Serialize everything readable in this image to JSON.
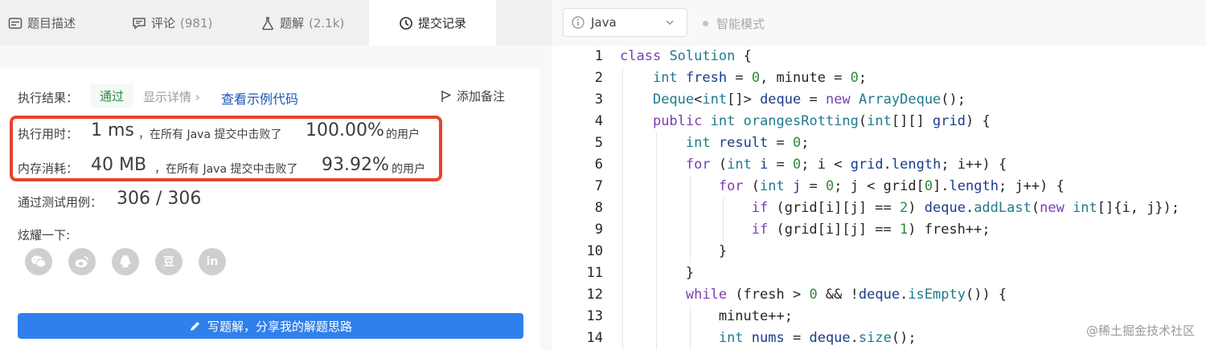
{
  "tabs": [
    {
      "label": "题目描述",
      "count": ""
    },
    {
      "label": "评论",
      "count": "(981)"
    },
    {
      "label": "题解",
      "count": "(2.1k)"
    },
    {
      "label": "提交记录",
      "count": ""
    }
  ],
  "result": {
    "label": "执行结果：",
    "status": "通过",
    "details": "显示详情 ›",
    "example": "查看示例代码",
    "note": "添加备注"
  },
  "runtime": {
    "label": "执行用时：",
    "value": "1 ms",
    "mid": "，在所有 Java 提交中击败了",
    "percent": "100.00%",
    "suffix": "的用户"
  },
  "memory": {
    "label": "内存消耗：",
    "value": "40 MB",
    "mid": "，在所有 Java 提交中击败了",
    "percent": "93.92%",
    "suffix": "的用户"
  },
  "tests": {
    "label": "通过测试用例：",
    "value": "306 / 306"
  },
  "share": {
    "label": "炫耀一下:",
    "icons": [
      "wechat-icon",
      "weibo-icon",
      "qq-icon",
      "douban-icon",
      "linkedin-icon"
    ],
    "douban_text": "豆",
    "linkedin_text": "in"
  },
  "write_button": "写题解，分享我的解题思路",
  "editor": {
    "language": "Java",
    "smart_mode": "智能模式",
    "watermark": "@稀土掘金技术社区",
    "line_numbers": [
      "1",
      "2",
      "3",
      "4",
      "5",
      "6",
      "7",
      "8",
      "9",
      "10",
      "11",
      "12",
      "13",
      "14"
    ]
  },
  "colors": {
    "accent": "#2f80ed",
    "highlight": "#e5432f",
    "pass": "#2e8b3e"
  }
}
